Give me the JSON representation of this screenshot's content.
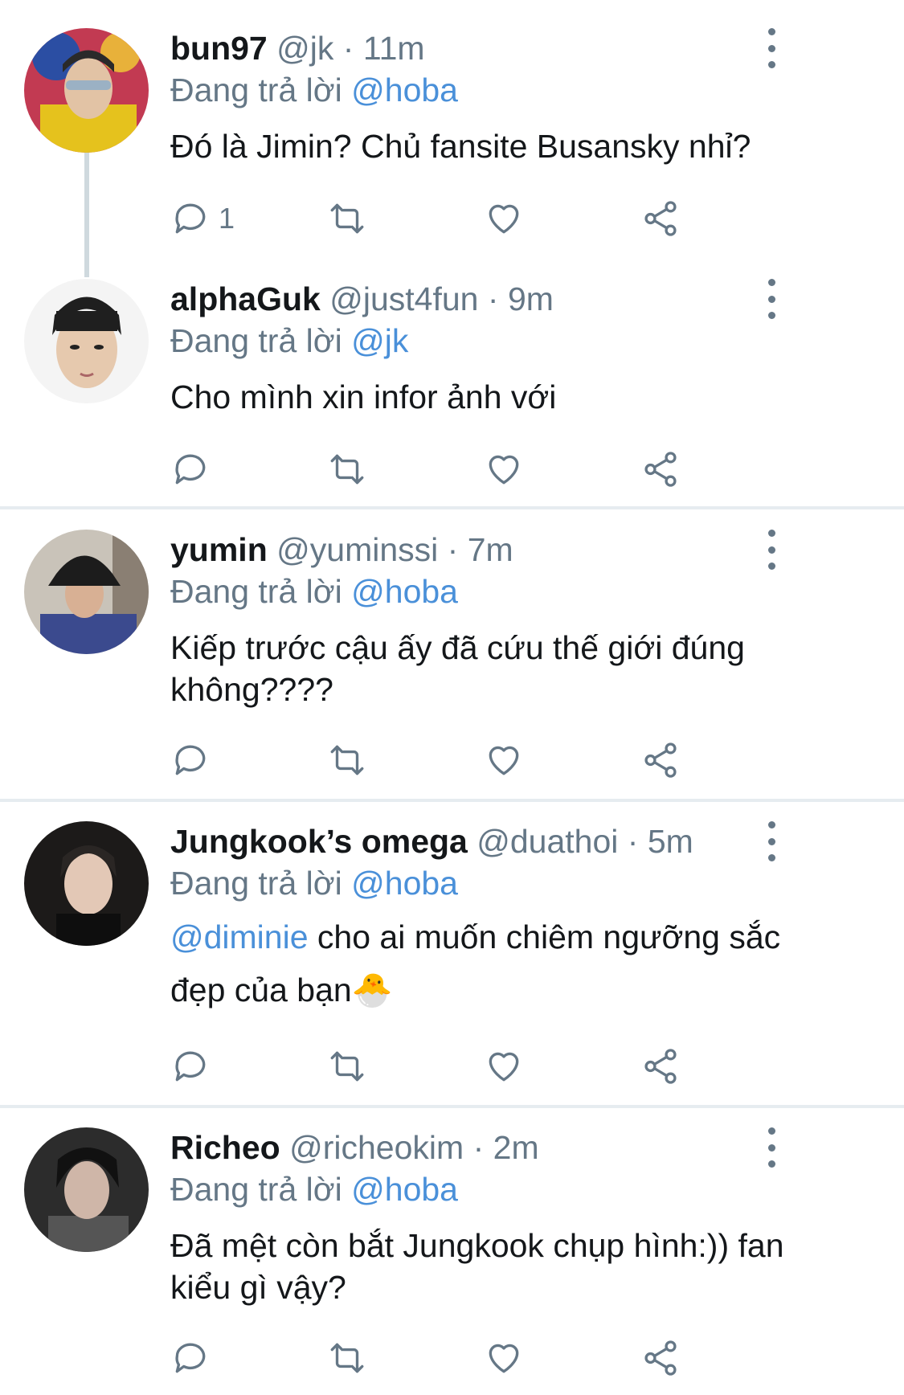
{
  "reply_prefix": "Đang trả lời",
  "tweets": [
    {
      "name": "bun97",
      "handle": "@jk",
      "dot": "·",
      "time": "11m",
      "reply_to": "@hoba",
      "body": "Đó là Jimin? Chủ fansite Busansky nhỉ?",
      "reply_count": "1",
      "avatar_icon": "avatar-photo"
    },
    {
      "name": "alphaGuk",
      "handle": "@just4fun",
      "dot": "·",
      "time": "9m",
      "reply_to": "@jk",
      "body": "Cho mình xin infor ảnh với",
      "reply_count": "",
      "avatar_icon": "avatar-photo"
    },
    {
      "name": "yumin",
      "handle": "@yuminssi",
      "dot": "·",
      "time": "7m",
      "reply_to": "@hoba",
      "body": "Kiếp trước cậu ấy đã cứu thế giới đúng không????",
      "reply_count": "",
      "avatar_icon": "avatar-photo"
    },
    {
      "name": "Jungkook’s omega",
      "handle": "@duathoi",
      "dot": "·",
      "time": "5m",
      "reply_to": "@hoba",
      "body_mention": "@diminie",
      "body": " cho ai muốn chiêm ngưỡng sắc đẹp của bạn🐣",
      "reply_count": "",
      "avatar_icon": "avatar-photo"
    },
    {
      "name": "Richeo",
      "handle": "@richeokim",
      "dot": "·",
      "time": "2m",
      "reply_to": "@hoba",
      "body": "Đã mệt còn bắt Jungkook chụp hình:)) fan kiểu gì vậy?",
      "reply_count": "",
      "avatar_icon": "avatar-photo"
    }
  ],
  "icons": {
    "reply": "reply-icon",
    "retweet": "retweet-icon",
    "like": "heart-icon",
    "share": "share-icon",
    "more": "more-vertical-icon"
  },
  "colors": {
    "mention": "#4a90d9",
    "secondary_text": "#657786",
    "divider": "#e6ecf0"
  }
}
